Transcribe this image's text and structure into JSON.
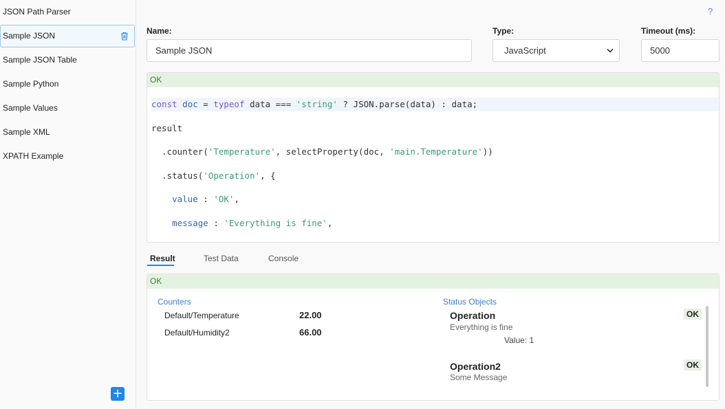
{
  "sidebar": {
    "items": [
      {
        "label": "JSON Path Parser"
      },
      {
        "label": "Sample JSON"
      },
      {
        "label": "Sample JSON Table"
      },
      {
        "label": "Sample Python"
      },
      {
        "label": "Sample Values"
      },
      {
        "label": "Sample XML"
      },
      {
        "label": "XPATH Example"
      }
    ],
    "add_label": "+"
  },
  "help_label": "?",
  "form": {
    "name_label": "Name:",
    "name_value": "Sample JSON",
    "type_label": "Type:",
    "type_value": "JavaScript",
    "timeout_label": "Timeout (ms):",
    "timeout_value": "5000"
  },
  "editor": {
    "status": "OK"
  },
  "tabs": [
    "Result",
    "Test Data",
    "Console"
  ],
  "result": {
    "status": "OK",
    "counters_title": "Counters",
    "counters": [
      {
        "name": "Default/Temperature",
        "value": "22.00"
      },
      {
        "name": "Default/Humidity2",
        "value": "66.00"
      }
    ],
    "status_title": "Status Objects",
    "statuses": [
      {
        "name": "Operation",
        "message": "Everything is fine",
        "badge": "OK",
        "data_key": "Value",
        "data_sep": ":",
        "data_value": "1"
      },
      {
        "name": "Operation2",
        "message": "Some Message",
        "badge": "OK"
      }
    ]
  },
  "colors": {
    "accent": "#1e88e5",
    "ok_bg": "#e6f2e1",
    "link": "#3d7fc9"
  }
}
